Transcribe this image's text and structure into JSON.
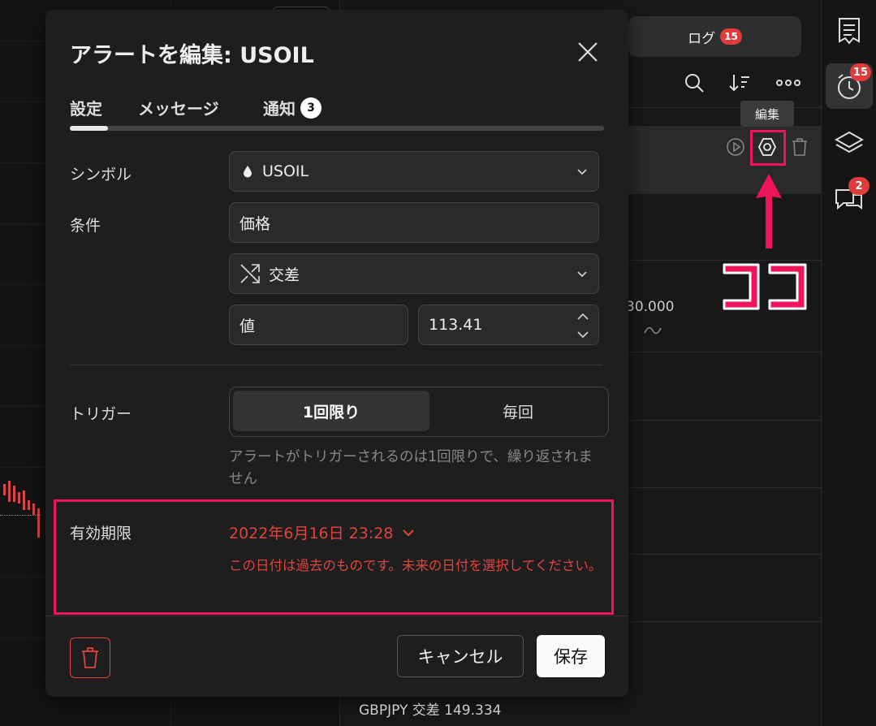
{
  "panel": {
    "log_tab_label": "ログ",
    "log_badge": "15",
    "edit_tooltip": "編集",
    "peek_price": "30.000",
    "peek_bottom": "GBPJPY 交差 149.334"
  },
  "sidebar": {
    "alerts_badge": "15",
    "chat_badge": "2"
  },
  "annotation": {
    "koko_text": "ココ"
  },
  "dialog": {
    "title": "アラートを編集: USOIL",
    "tabs": [
      {
        "label": "設定"
      },
      {
        "label": "メッセージ"
      },
      {
        "label": "通知",
        "badge": "3"
      }
    ],
    "symbol_label": "シンボル",
    "symbol_value": "USOIL",
    "condition_label": "条件",
    "condition_source": "価格",
    "condition_operator": "交差",
    "value_type": "値",
    "value_number": "113.41",
    "trigger_label": "トリガー",
    "trigger_options": [
      "1回限り",
      "毎回"
    ],
    "trigger_selected": "1回限り",
    "trigger_hint": "アラートがトリガーされるのは1回限りで、繰り返されません",
    "expiry_label": "有効期限",
    "expiry_value": "2022年6月16日 23:28",
    "expiry_error": "この日付は過去のものです。未来の日付を選択してください。",
    "cancel_label": "キャンセル",
    "save_label": "保存"
  },
  "colors": {
    "accent_error": "#e0443f",
    "highlight": "#f0145a",
    "badge": "#e03c3c"
  },
  "icons": [
    "droplet-icon",
    "crossing-icon",
    "chevron-down-icon",
    "stepper-icon",
    "trash-icon",
    "close-icon",
    "search-icon",
    "sort-icon",
    "more-icon",
    "play-icon",
    "settings-icon",
    "notes-icon",
    "alarm-icon",
    "layers-icon",
    "chat-icon"
  ]
}
